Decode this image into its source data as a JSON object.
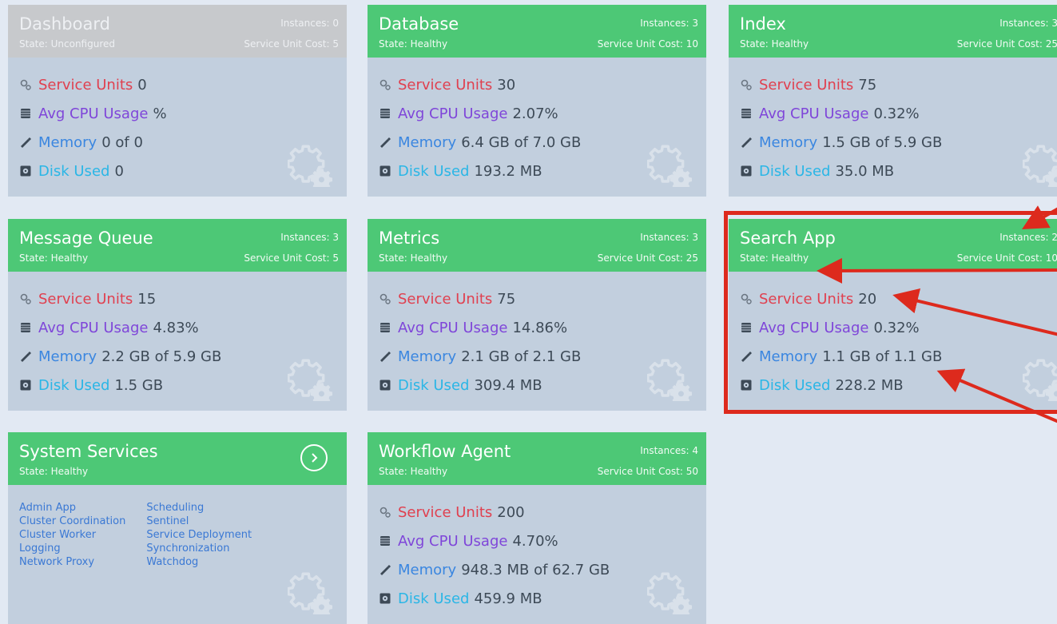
{
  "labels": {
    "state_prefix": "State: ",
    "instances_prefix": "Instances: ",
    "cost_prefix": "Service Unit Cost: ",
    "service_units": "Service Units",
    "cpu": "Avg CPU Usage",
    "memory": "Memory",
    "disk": "Disk Used"
  },
  "cards": [
    {
      "title": "Dashboard",
      "state": "Unconfigured",
      "instances": "0",
      "cost": "5",
      "service_units": "0",
      "cpu": "%",
      "memory": "0 of 0",
      "disk": "0"
    },
    {
      "title": "Database",
      "state": "Healthy",
      "instances": "3",
      "cost": "10",
      "service_units": "30",
      "cpu": "2.07%",
      "memory": "6.4 GB of 7.0 GB",
      "disk": "193.2 MB"
    },
    {
      "title": "Index",
      "state": "Healthy",
      "instances": "3",
      "cost": "25",
      "service_units": "75",
      "cpu": "0.32%",
      "memory": "1.5 GB of 5.9 GB",
      "disk": "35.0 MB"
    },
    {
      "title": "Message Queue",
      "state": "Healthy",
      "instances": "3",
      "cost": "5",
      "service_units": "15",
      "cpu": "4.83%",
      "memory": "2.2 GB of 5.9 GB",
      "disk": "1.5 GB"
    },
    {
      "title": "Metrics",
      "state": "Healthy",
      "instances": "3",
      "cost": "25",
      "service_units": "75",
      "cpu": "14.86%",
      "memory": "2.1 GB of 2.1 GB",
      "disk": "309.4 MB"
    },
    {
      "title": "Search App",
      "state": "Healthy",
      "instances": "2",
      "cost": "10",
      "service_units": "20",
      "cpu": "0.32%",
      "memory": "1.1 GB of 1.1 GB",
      "disk": "228.2 MB"
    },
    {
      "title": "Workflow Agent",
      "state": "Healthy",
      "instances": "4",
      "cost": "50",
      "service_units": "200",
      "cpu": "4.70%",
      "memory": "948.3 MB of 62.7 GB",
      "disk": "459.9 MB"
    }
  ],
  "system_services": {
    "title": "System Services",
    "state": "Healthy",
    "col1": [
      "Admin App",
      "Cluster Coordination",
      "Cluster Worker",
      "Logging",
      "Network Proxy"
    ],
    "col2": [
      "Scheduling",
      "Sentinel",
      "Service Deployment",
      "Synchronization",
      "Watchdog"
    ]
  },
  "colors": {
    "healthy_header": "#4dc876",
    "unconfigured_header": "#c7c9cc",
    "card_body": "#c2cfde",
    "page_bg": "#e2e9f3",
    "service_units_label": "#e0404f",
    "cpu_label": "#7f46d9",
    "memory_label": "#3a86e0",
    "disk_label": "#2ab6e6",
    "annotation": "#dd2a1d"
  },
  "icons": [
    "gears-icon",
    "cpu-chip-icon",
    "memory-stick-icon",
    "disk-icon",
    "expand-circle-arrow-icon"
  ]
}
